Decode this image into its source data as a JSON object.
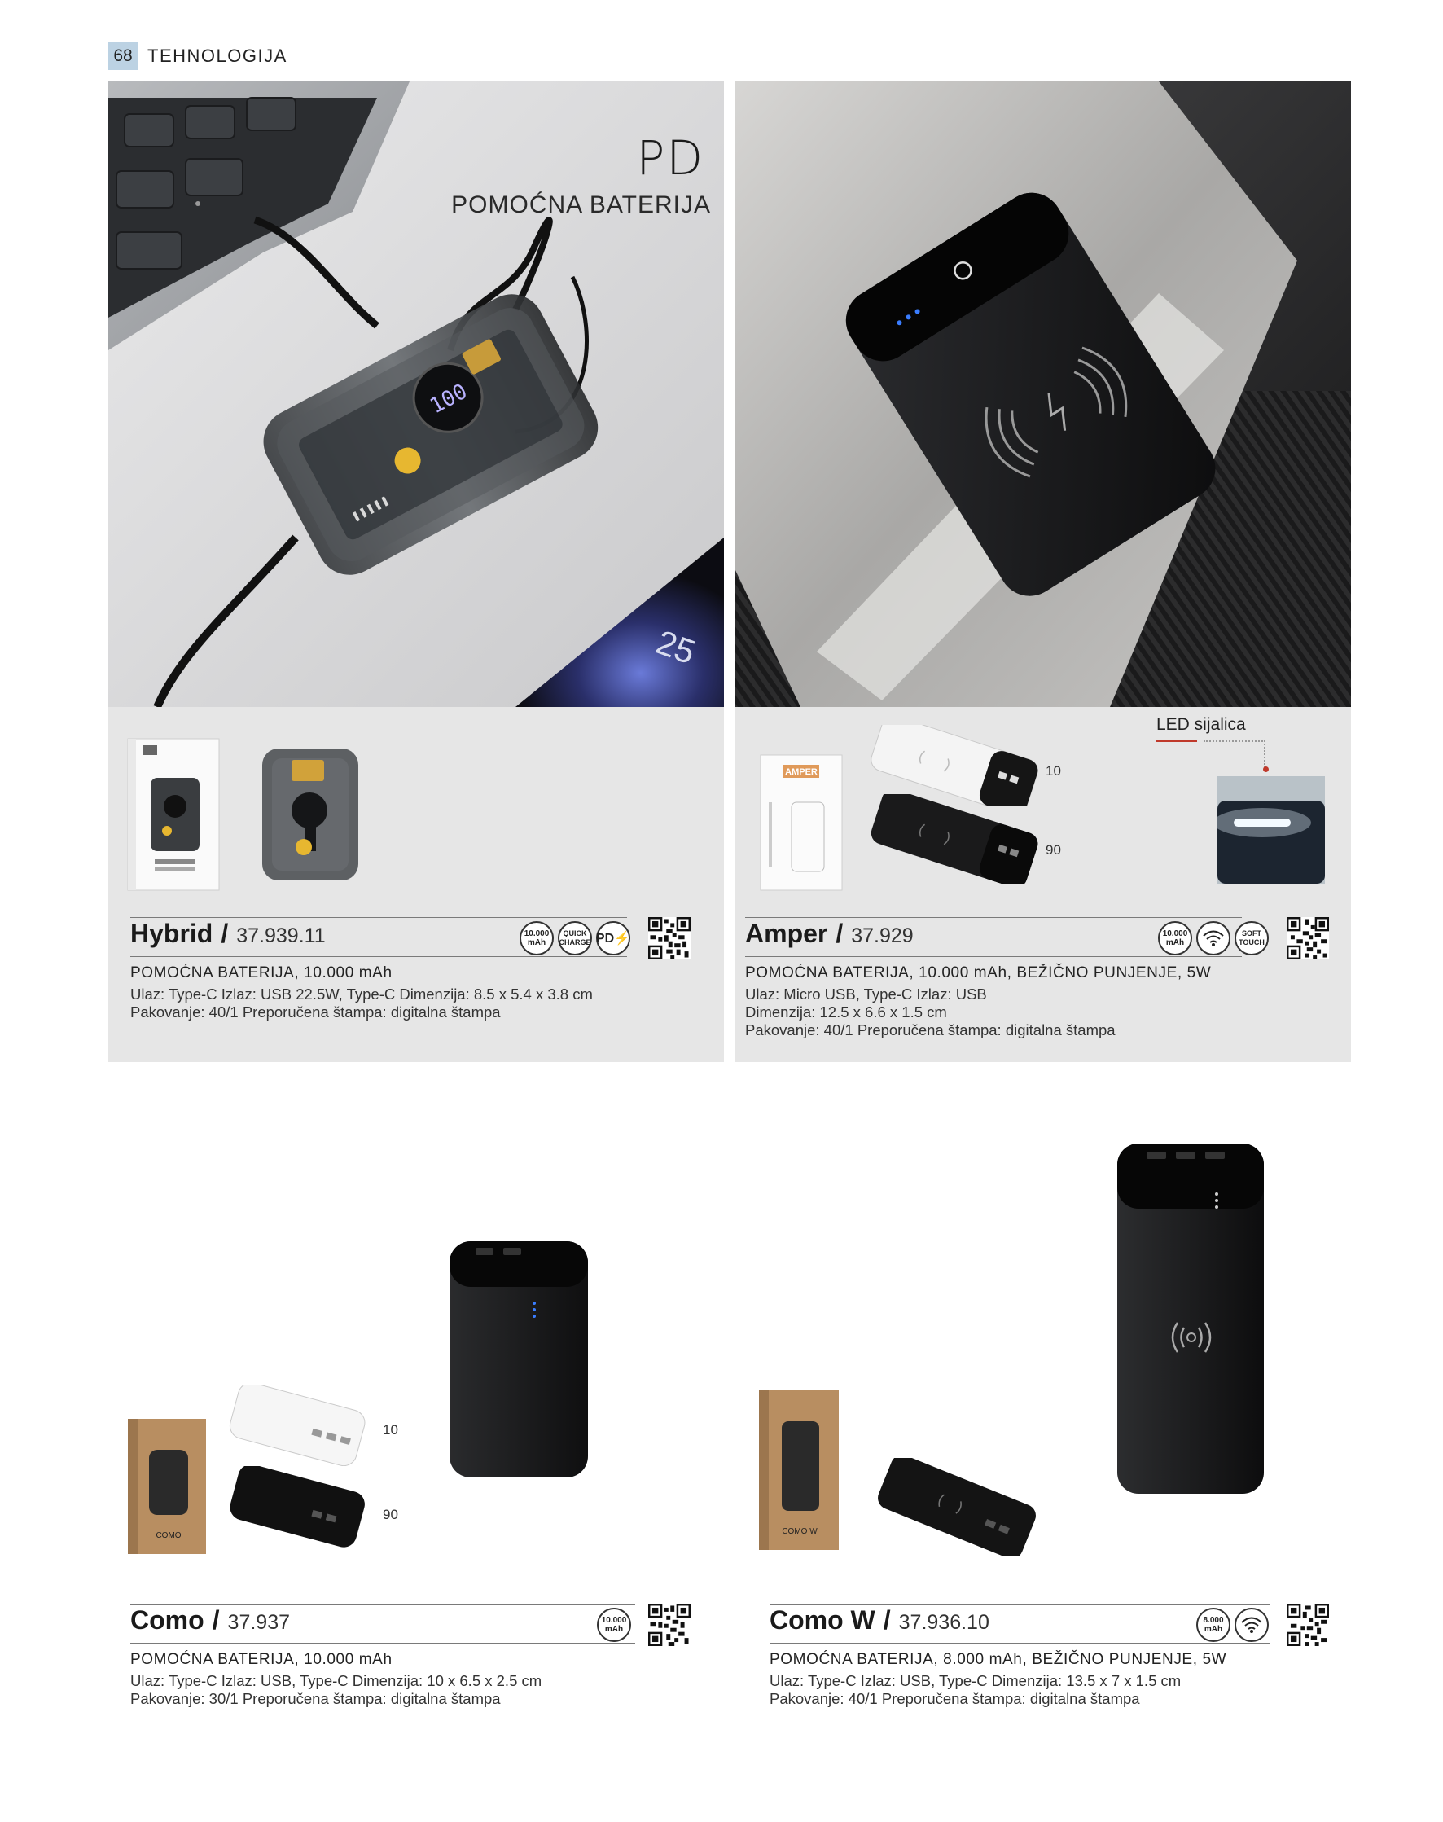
{
  "header": {
    "page_number": "68",
    "section": "TEHNOLOGIJA"
  },
  "hero": {
    "title": "PD",
    "subtitle": "POMOĆNA BATERIJA",
    "screen_percent": "25",
    "device_display": "100"
  },
  "products": [
    {
      "name": "Hybrid",
      "code": "37.939.11",
      "badges": [
        "10.000 mAh",
        "QUICK CHARGE",
        "PD"
      ],
      "headline": "POMOĆNA BATERIJA, 10.000 mAh",
      "lines": [
        "Ulaz: Type-C Izlaz: USB 22.5W, Type-C Dimenzija: 8.5 x 5.4 x 3.8 cm",
        "Pakovanje: 40/1 Preporučena štampa: digitalna štampa"
      ]
    },
    {
      "name": "Amper",
      "code": "37.929",
      "badges": [
        "10.000 mAh",
        "wireless",
        "SOFT TOUCH"
      ],
      "headline": "POMOĆNA BATERIJA, 10.000 mAh, BEŽIČNO PUNJENJE, 5W",
      "lines": [
        "Ulaz: Micro USB, Type-C Izlaz: USB",
        "Dimenzija: 12.5 x 6.6 x 1.5 cm",
        "Pakovanje: 40/1 Preporučena štampa: digitalna štampa"
      ],
      "color_codes": [
        "10",
        "90"
      ],
      "led_label": "LED sijalica",
      "box_label": "AMPER"
    },
    {
      "name": "Como",
      "code": "37.937",
      "badges": [
        "10.000 mAh"
      ],
      "headline": "POMOĆNA BATERIJA, 10.000 mAh",
      "lines": [
        "Ulaz: Type-C Izlaz: USB, Type-C Dimenzija: 10 x 6.5 x 2.5 cm",
        "Pakovanje: 30/1 Preporučena štampa: digitalna štampa"
      ],
      "color_codes": [
        "10",
        "90"
      ],
      "box_label": "COMO"
    },
    {
      "name": "Como W",
      "code": "37.936.10",
      "badges": [
        "8.000 mAh",
        "wireless"
      ],
      "headline": "POMOĆNA BATERIJA, 8.000 mAh, BEŽIČNO PUNJENJE, 5W",
      "lines": [
        "Ulaz: Type-C Izlaz: USB, Type-C Dimenzija: 13.5 x 7 x 1.5 cm",
        "Pakovanje: 40/1 Preporučena štampa: digitalna štampa"
      ],
      "box_label": "COMO W"
    }
  ],
  "badge_text": {
    "b10000_top": "10.000",
    "b10000_bot": "mAh",
    "b8000_top": "8.000",
    "b8000_bot": "mAh",
    "quick_top": "QUICK",
    "quick_bot": "CHARGE",
    "pd": "PD",
    "soft_top": "SOFT",
    "soft_bot": "TOUCH"
  },
  "icons": {
    "wireless": "wifi-signal-icon",
    "pd": "pd-lightning-icon",
    "qr": "qr-code-icon"
  },
  "colors": {
    "panel": "#e6e6e6",
    "page_tab": "#bcd2e3",
    "led_marker": "#c0392b"
  }
}
